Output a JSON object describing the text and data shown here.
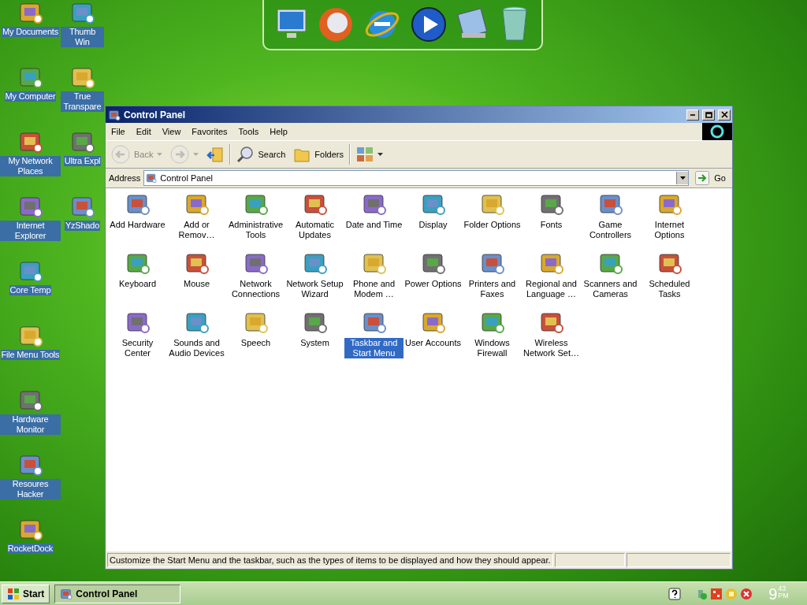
{
  "desktop": {
    "left_column": [
      {
        "label": "My Documents"
      },
      {
        "label": "My Computer"
      },
      {
        "label": "My Network Places"
      },
      {
        "label": "Internet Explorer"
      },
      {
        "label": "Core Temp"
      },
      {
        "label": "File Menu Tools"
      },
      {
        "label": "Hardware Monitor"
      },
      {
        "label": "Resoures Hacker"
      },
      {
        "label": "RocketDock"
      }
    ],
    "right_column": [
      {
        "label": "Thumb Win"
      },
      {
        "label": "True Transpare"
      },
      {
        "label": "Ultra Expl"
      },
      {
        "label": "YzShado"
      }
    ]
  },
  "window": {
    "title": "Control Panel",
    "menu": [
      "File",
      "Edit",
      "View",
      "Favorites",
      "Tools",
      "Help"
    ],
    "toolbar": {
      "back": {
        "label": "Back",
        "disabled": true
      },
      "forward": {
        "disabled": true
      },
      "search": "Search",
      "folders": "Folders"
    },
    "address": {
      "label": "Address",
      "value": "Control Panel",
      "go": "Go"
    },
    "items": [
      {
        "label": "Add Hardware",
        "selected": false
      },
      {
        "label": "Add or Remov…",
        "selected": false
      },
      {
        "label": "Administrative Tools",
        "selected": false
      },
      {
        "label": "Automatic Updates",
        "selected": false
      },
      {
        "label": "Date and Time",
        "selected": false
      },
      {
        "label": "Display",
        "selected": false
      },
      {
        "label": "Folder Options",
        "selected": false
      },
      {
        "label": "Fonts",
        "selected": false
      },
      {
        "label": "Game Controllers",
        "selected": false
      },
      {
        "label": "Internet Options",
        "selected": false
      },
      {
        "label": "Keyboard",
        "selected": false
      },
      {
        "label": "Mouse",
        "selected": false
      },
      {
        "label": "Network Connections",
        "selected": false
      },
      {
        "label": "Network Setup Wizard",
        "selected": false
      },
      {
        "label": "Phone and Modem …",
        "selected": false
      },
      {
        "label": "Power Options",
        "selected": false
      },
      {
        "label": "Printers and Faxes",
        "selected": false
      },
      {
        "label": "Regional and Language …",
        "selected": false
      },
      {
        "label": "Scanners and Cameras",
        "selected": false
      },
      {
        "label": "Scheduled Tasks",
        "selected": false
      },
      {
        "label": "Security Center",
        "selected": false
      },
      {
        "label": "Sounds and Audio Devices",
        "selected": false
      },
      {
        "label": "Speech",
        "selected": false
      },
      {
        "label": "System",
        "selected": false
      },
      {
        "label": "Taskbar and Start Menu",
        "selected": true
      },
      {
        "label": "User Accounts",
        "selected": false
      },
      {
        "label": "Windows Firewall",
        "selected": false
      },
      {
        "label": "Wireless Network Set…",
        "selected": false
      }
    ],
    "status_text": "Customize the Start Menu and the taskbar, such as the types of items to be displayed and how they should appear."
  },
  "taskbar": {
    "start": "Start",
    "tasks": [
      {
        "label": "Control Panel",
        "selected": true
      }
    ],
    "clock": {
      "hour": "9",
      "minutes": "43",
      "ampm": "PM"
    }
  }
}
